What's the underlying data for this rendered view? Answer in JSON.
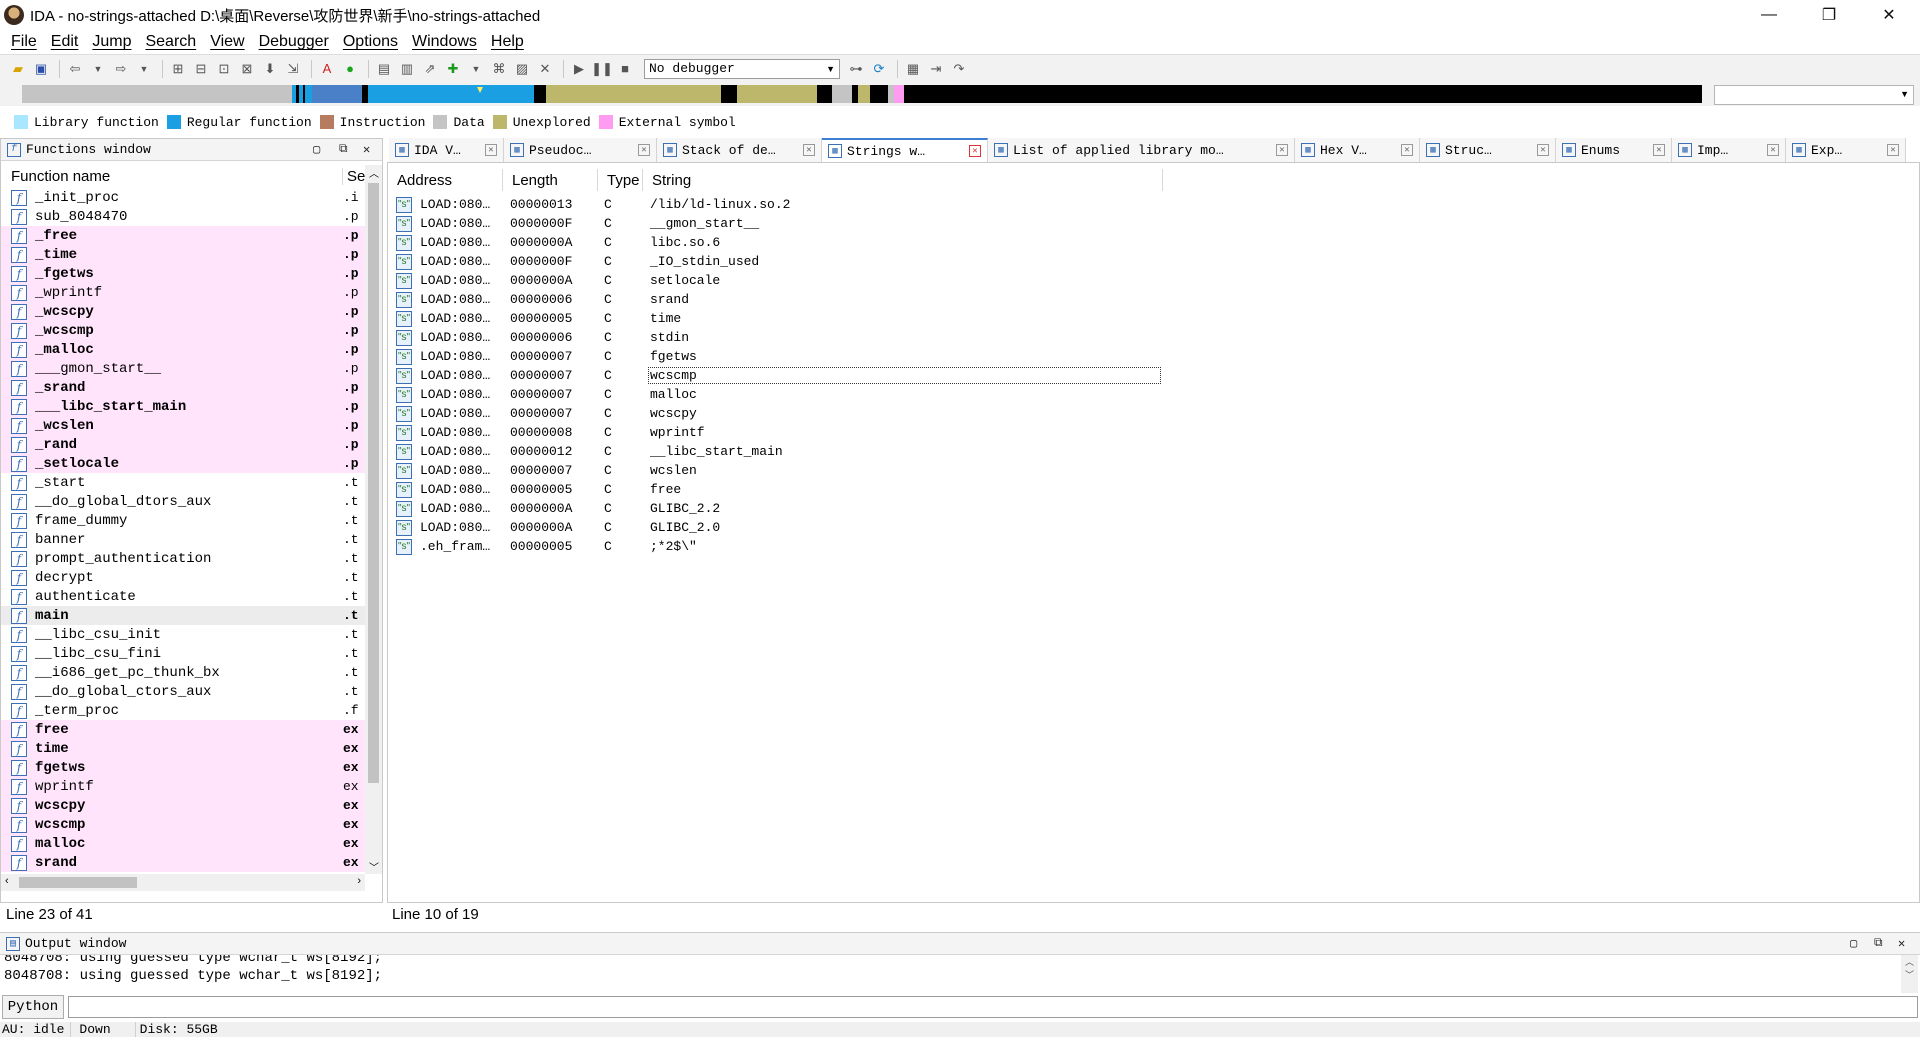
{
  "window": {
    "title": "IDA - no-strings-attached D:\\桌面\\Reverse\\攻防世界\\新手\\no-strings-attached",
    "minimize": "—",
    "restore": "❐",
    "close": "✕"
  },
  "menu": [
    "File",
    "Edit",
    "Jump",
    "Search",
    "View",
    "Debugger",
    "Options",
    "Windows",
    "Help"
  ],
  "toolbar": {
    "debugger_select": "No debugger"
  },
  "legend": [
    {
      "label": "Library function",
      "color": "#a8e7ff"
    },
    {
      "label": "Regular function",
      "color": "#1a9fe3"
    },
    {
      "label": "Instruction",
      "color": "#b77b5f"
    },
    {
      "label": "Data",
      "color": "#c4c4c4"
    },
    {
      "label": "Unexplored",
      "color": "#bdb76b"
    },
    {
      "label": "External symbol",
      "color": "#ff9cf2"
    }
  ],
  "functions_window": {
    "title": "Functions window",
    "col_name": "Function name",
    "col_segment": "Se",
    "status": "Line 23 of 41",
    "rows": [
      {
        "name": "_init_proc",
        "seg": ".i",
        "style": "normal"
      },
      {
        "name": "sub_8048470",
        "seg": ".p",
        "style": "normal"
      },
      {
        "name": "_free",
        "seg": ".p",
        "style": "ext"
      },
      {
        "name": "_time",
        "seg": ".p",
        "style": "ext"
      },
      {
        "name": "_fgetws",
        "seg": ".p",
        "style": "ext"
      },
      {
        "name": "_wprintf",
        "seg": ".p",
        "style": "ext-light"
      },
      {
        "name": "_wcscpy",
        "seg": ".p",
        "style": "ext"
      },
      {
        "name": "_wcscmp",
        "seg": ".p",
        "style": "ext"
      },
      {
        "name": "_malloc",
        "seg": ".p",
        "style": "ext"
      },
      {
        "name": "___gmon_start__",
        "seg": ".p",
        "style": "ext-light"
      },
      {
        "name": "_srand",
        "seg": ".p",
        "style": "ext"
      },
      {
        "name": "___libc_start_main",
        "seg": ".p",
        "style": "ext"
      },
      {
        "name": "_wcslen",
        "seg": ".p",
        "style": "ext"
      },
      {
        "name": "_rand",
        "seg": ".p",
        "style": "ext"
      },
      {
        "name": "_setlocale",
        "seg": ".p",
        "style": "ext"
      },
      {
        "name": "_start",
        "seg": ".t",
        "style": "normal"
      },
      {
        "name": "__do_global_dtors_aux",
        "seg": ".t",
        "style": "normal"
      },
      {
        "name": "frame_dummy",
        "seg": ".t",
        "style": "normal"
      },
      {
        "name": "banner",
        "seg": ".t",
        "style": "normal"
      },
      {
        "name": "prompt_authentication",
        "seg": ".t",
        "style": "normal"
      },
      {
        "name": "decrypt",
        "seg": ".t",
        "style": "normal"
      },
      {
        "name": "authenticate",
        "seg": ".t",
        "style": "normal"
      },
      {
        "name": "main",
        "seg": ".t",
        "style": "selected"
      },
      {
        "name": "__libc_csu_init",
        "seg": ".t",
        "style": "normal"
      },
      {
        "name": "__libc_csu_fini",
        "seg": ".t",
        "style": "normal"
      },
      {
        "name": "__i686_get_pc_thunk_bx",
        "seg": ".t",
        "style": "normal"
      },
      {
        "name": "__do_global_ctors_aux",
        "seg": ".t",
        "style": "normal"
      },
      {
        "name": "_term_proc",
        "seg": ".f",
        "style": "normal"
      },
      {
        "name": "free",
        "seg": "ex",
        "style": "ext"
      },
      {
        "name": "time",
        "seg": "ex",
        "style": "ext"
      },
      {
        "name": "fgetws",
        "seg": "ex",
        "style": "ext"
      },
      {
        "name": "wprintf",
        "seg": "ex",
        "style": "ext-light"
      },
      {
        "name": "wcscpy",
        "seg": "ex",
        "style": "ext"
      },
      {
        "name": "wcscmp",
        "seg": "ex",
        "style": "ext"
      },
      {
        "name": "malloc",
        "seg": "ex",
        "style": "ext"
      },
      {
        "name": "srand",
        "seg": "ex",
        "style": "ext"
      }
    ]
  },
  "tabs": [
    {
      "label": "IDA V…",
      "icon": "ida-view-icon",
      "active": false
    },
    {
      "label": "Pseudoc…",
      "icon": "pseudocode-icon",
      "active": false
    },
    {
      "label": "Stack of de…",
      "icon": "stack-icon",
      "active": false
    },
    {
      "label": "Strings w…",
      "icon": "strings-icon",
      "active": true
    },
    {
      "label": "List of applied library mo…",
      "icon": "library-list-icon",
      "active": false
    },
    {
      "label": "Hex V…",
      "icon": "hex-view-icon",
      "active": false
    },
    {
      "label": "Struc…",
      "icon": "structures-icon",
      "active": false
    },
    {
      "label": "Enums",
      "icon": "enums-icon",
      "active": false
    },
    {
      "label": "Imp…",
      "icon": "imports-icon",
      "active": false
    },
    {
      "label": "Exp…",
      "icon": "exports-icon",
      "active": false
    }
  ],
  "strings_window": {
    "col_address": "Address",
    "col_length": "Length",
    "col_type": "Type",
    "col_string": "String",
    "status": "Line 10 of 19",
    "rows": [
      {
        "address": "LOAD:080…",
        "length": "00000013",
        "type": "C",
        "string": "/lib/ld-linux.so.2"
      },
      {
        "address": "LOAD:080…",
        "length": "0000000F",
        "type": "C",
        "string": "__gmon_start__"
      },
      {
        "address": "LOAD:080…",
        "length": "0000000A",
        "type": "C",
        "string": "libc.so.6"
      },
      {
        "address": "LOAD:080…",
        "length": "0000000F",
        "type": "C",
        "string": "_IO_stdin_used"
      },
      {
        "address": "LOAD:080…",
        "length": "0000000A",
        "type": "C",
        "string": "setlocale"
      },
      {
        "address": "LOAD:080…",
        "length": "00000006",
        "type": "C",
        "string": "srand"
      },
      {
        "address": "LOAD:080…",
        "length": "00000005",
        "type": "C",
        "string": "time"
      },
      {
        "address": "LOAD:080…",
        "length": "00000006",
        "type": "C",
        "string": "stdin"
      },
      {
        "address": "LOAD:080…",
        "length": "00000007",
        "type": "C",
        "string": "fgetws"
      },
      {
        "address": "LOAD:080…",
        "length": "00000007",
        "type": "C",
        "string": "wcscmp"
      },
      {
        "address": "LOAD:080…",
        "length": "00000007",
        "type": "C",
        "string": "malloc"
      },
      {
        "address": "LOAD:080…",
        "length": "00000007",
        "type": "C",
        "string": "wcscpy"
      },
      {
        "address": "LOAD:080…",
        "length": "00000008",
        "type": "C",
        "string": "wprintf"
      },
      {
        "address": "LOAD:080…",
        "length": "00000012",
        "type": "C",
        "string": "__libc_start_main"
      },
      {
        "address": "LOAD:080…",
        "length": "00000007",
        "type": "C",
        "string": "wcslen"
      },
      {
        "address": "LOAD:080…",
        "length": "00000005",
        "type": "C",
        "string": "free"
      },
      {
        "address": "LOAD:080…",
        "length": "0000000A",
        "type": "C",
        "string": "GLIBC_2.2"
      },
      {
        "address": "LOAD:080…",
        "length": "0000000A",
        "type": "C",
        "string": "GLIBC_2.0"
      },
      {
        "address": ".eh_fram…",
        "length": "00000005",
        "type": "C",
        "string": ";*2$\\\""
      }
    ]
  },
  "output_window": {
    "title": "Output window",
    "lines": [
      "8048708: using guessed type wchar_t ws[8192];",
      "8048708: using guessed type wchar_t ws[8192];"
    ]
  },
  "python_button": "Python",
  "statusbar": {
    "au": "AU:  idle",
    "direction": "Down",
    "disk": "Disk: 55GB"
  }
}
